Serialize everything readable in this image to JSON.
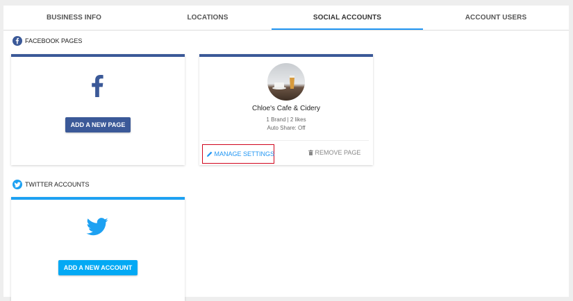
{
  "tabs": [
    {
      "label": "BUSINESS INFO"
    },
    {
      "label": "LOCATIONS"
    },
    {
      "label": "SOCIAL ACCOUNTS"
    },
    {
      "label": "ACCOUNT USERS"
    }
  ],
  "active_tab": "SOCIAL ACCOUNTS",
  "facebook_section": {
    "label": "FACEBOOK PAGES",
    "icon": "facebook-icon",
    "add_card": {
      "button_label": "ADD A NEW PAGE",
      "icon": "facebook-f-icon"
    },
    "page_card": {
      "name": "Chloe's Cafe & Cidery",
      "stats": "1 Brand | 2 likes",
      "auto_share": "Auto Share: Off",
      "manage_label": "MANAGE SETTINGS",
      "remove_label": "REMOVE PAGE",
      "manage_icon": "pencil-icon",
      "remove_icon": "trash-icon"
    }
  },
  "twitter_section": {
    "label": "TWITTER ACCOUNTS",
    "icon": "twitter-icon",
    "add_card": {
      "button_label": "ADD A NEW ACCOUNT",
      "icon": "twitter-bird-icon"
    }
  },
  "colors": {
    "facebook": "#3b5998",
    "twitter": "#1da1f2",
    "accent": "#2196f3",
    "highlight": "#d0021b"
  }
}
